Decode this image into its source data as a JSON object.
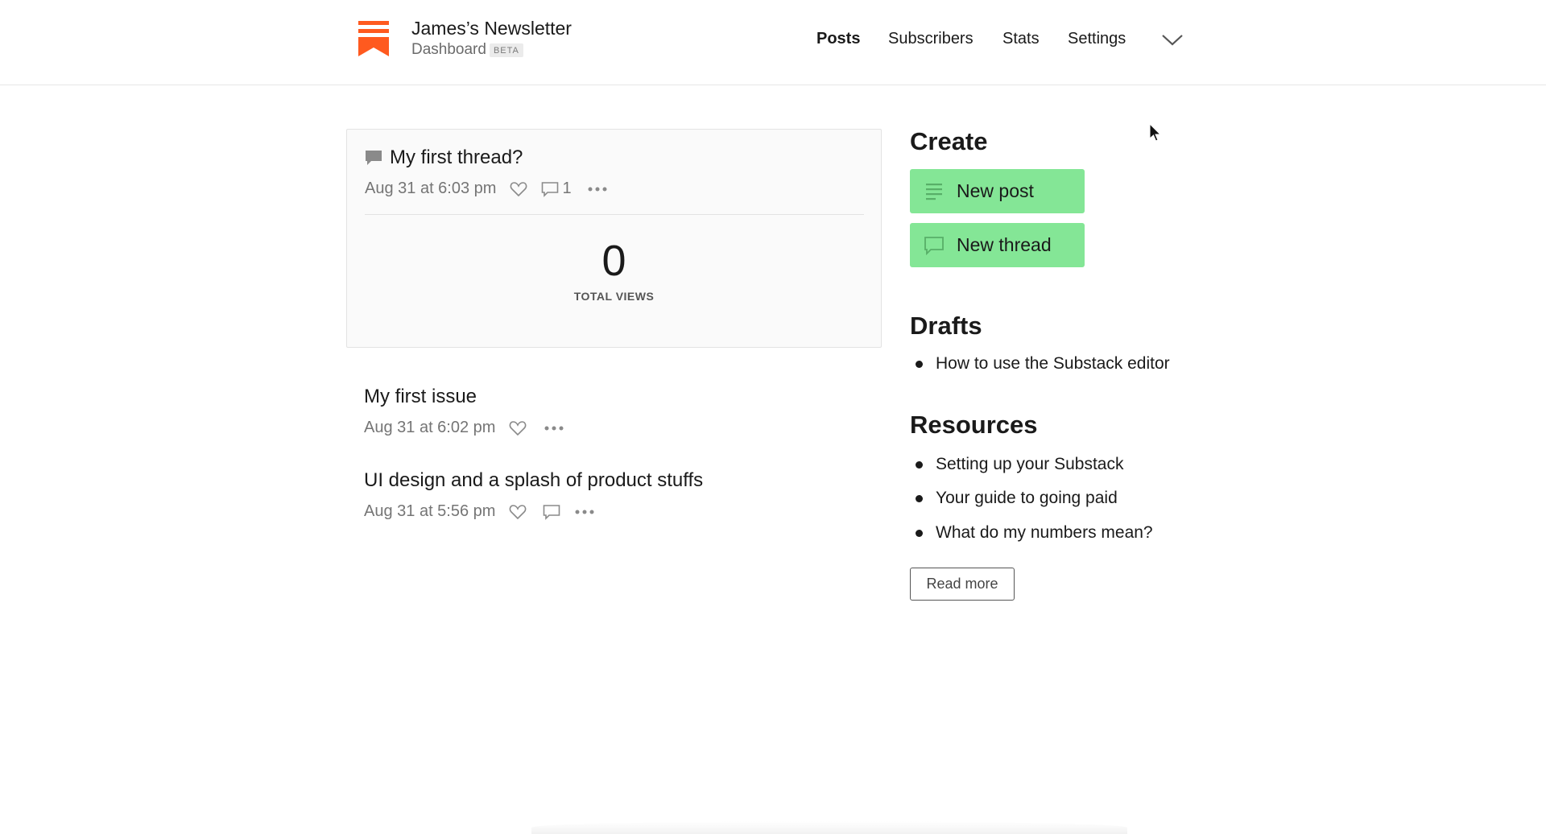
{
  "header": {
    "newsletter_name": "James’s Newsletter",
    "subtitle": "Dashboard",
    "beta_badge": "BETA",
    "brand_color": "#ff5a1f",
    "nav": {
      "posts": "Posts",
      "subscribers": "Subscribers",
      "stats": "Stats",
      "settings": "Settings"
    },
    "nav_active": "Posts",
    "more_icon": "chevron-down-icon"
  },
  "featured_thread": {
    "icon": "thread-bubble-icon",
    "title": "My first thread?",
    "date": "Aug 31 at 6:03 pm",
    "comment_count": "1",
    "total_views": "0",
    "total_views_label": "TOTAL VIEWS"
  },
  "posts": [
    {
      "title": "My first issue",
      "date": "Aug 31 at 6:02 pm"
    },
    {
      "title": "UI design and a splash of product stuffs",
      "date": "Aug 31 at 5:56 pm"
    }
  ],
  "create": {
    "heading": "Create",
    "new_post": "New post",
    "new_thread": "New thread",
    "button_color": "#84e696"
  },
  "drafts": {
    "heading": "Drafts",
    "items": [
      "How to use the Substack editor"
    ]
  },
  "resources": {
    "heading": "Resources",
    "items": [
      "Setting up your Substack",
      "Your guide to going paid",
      "What do my numbers mean?"
    ],
    "read_more": "Read more"
  }
}
